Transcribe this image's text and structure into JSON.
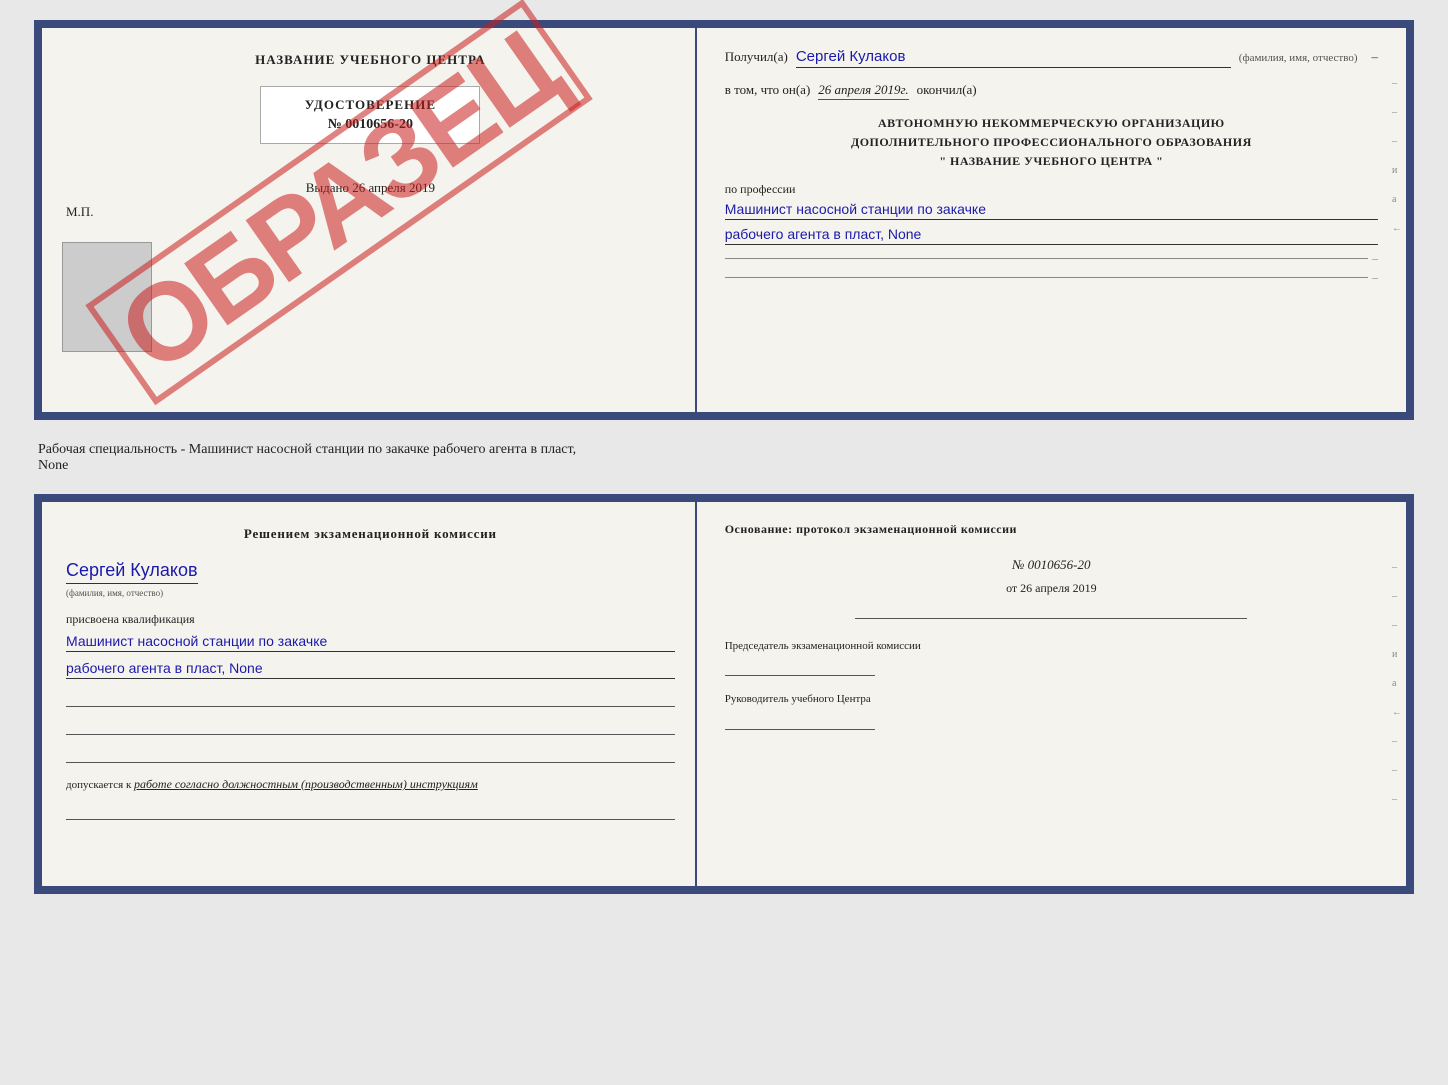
{
  "top": {
    "left": {
      "center_title": "НАЗВАНИЕ УЧЕБНОГО ЦЕНТРА",
      "udost_label": "УДОСТОВЕРЕНИЕ",
      "udost_number": "№ 0010656-20",
      "vydano_label": "Выдано",
      "vydano_date": "26 апреля 2019",
      "mp_label": "М.П.",
      "obrazec": "ОБРАЗЕЦ"
    },
    "right": {
      "poluchil_label": "Получил(a)",
      "poluchil_value": "Сергей Кулаков",
      "fio_hint": "(фамилия, имя, отчество)",
      "vtom_label": "в том, что он(а)",
      "vtom_date": "26 апреля 2019г.",
      "okonchil_label": "окончил(а)",
      "org_line1": "АВТОНОМНУЮ НЕКОММЕРЧЕСКУЮ ОРГАНИЗАЦИЮ",
      "org_line2": "ДОПОЛНИТЕЛЬНОГО ПРОФЕССИОНАЛЬНОГО ОБРАЗОВАНИЯ",
      "org_line3": "\"  НАЗВАНИЕ УЧЕБНОГО ЦЕНТРА  \"",
      "po_professii": "по профессии",
      "profession_line1": "Машинист насосной станции по закачке",
      "profession_line2": "рабочего агента в пласт, None"
    }
  },
  "separator": {
    "text1": "Рабочая специальность - Машинист насосной станции по закачке рабочего агента в пласт,",
    "text2": "None"
  },
  "bottom": {
    "left": {
      "title": "Решением экзаменационной комиссии",
      "name_cursive": "Сергей Кулаков",
      "fio_hint": "(фамилия, имя, отчество)",
      "prisvoena": "присвоена квалификация",
      "qual_line1": "Машинист насосной станции по закачке",
      "qual_line2": "рабочего агента в пласт, None",
      "dopusk_label": "допускается к",
      "dopusk_value": "работе согласно должностным (производственным) инструкциям"
    },
    "right": {
      "title": "Основание: протокол экзаменационной комиссии",
      "number": "№ 0010656-20",
      "date_prefix": "от",
      "date_value": "26 апреля 2019",
      "predsedatel_label": "Председатель экзаменационной комиссии",
      "rukovoditel_label": "Руководитель учебного Центра"
    }
  },
  "side_marks": [
    "-",
    "-",
    "-",
    "и",
    "а",
    "←",
    "-",
    "-",
    "-"
  ]
}
